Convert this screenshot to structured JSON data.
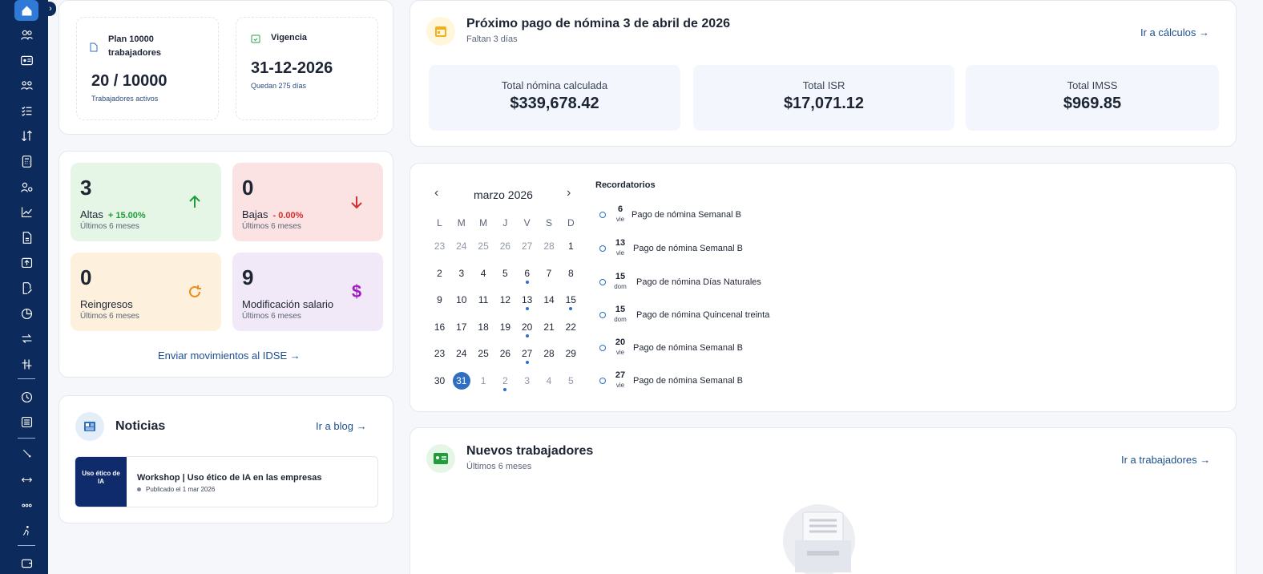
{
  "sidebar": {
    "icons": [
      "home-icon",
      "users-icon",
      "id-card-icon",
      "team-icon",
      "checklist-icon",
      "transfer-icon",
      "calculator-icon",
      "employee-key-icon",
      "chart-line-icon",
      "document-icon",
      "upload-icon",
      "edit-document-icon",
      "pie-chart-icon",
      "swap-icon",
      "adjust-icon",
      "clock-icon",
      "list-icon",
      "diagonal-icon",
      "dots-link-icon",
      "dots-icon",
      "run-icon",
      "wallet-icon"
    ]
  },
  "plan": {
    "plan_label": "Plan 10000 trabajadores",
    "plan_value": "20 / 10000",
    "plan_sub": "Trabajadores activos",
    "vigencia_label": "Vigencia",
    "vigencia_value": "31-12-2026",
    "vigencia_sub": "Quedan 275 días"
  },
  "payroll": {
    "title": "Próximo pago de nómina 3 de abril de 2026",
    "subtitle": "Faltan 3 días",
    "link": "Ir a cálculos →",
    "totals": [
      {
        "label": "Total nómina calculada",
        "value": "$339,678.42"
      },
      {
        "label": "Total ISR",
        "value": "$17,071.12"
      },
      {
        "label": "Total IMSS",
        "value": "$969.85"
      }
    ]
  },
  "movements": {
    "altas": {
      "value": "3",
      "label": "Altas",
      "pct": "+ 15.00%",
      "sub": "Últimos 6 meses",
      "color": "#1f9d3a"
    },
    "bajas": {
      "value": "0",
      "label": "Bajas",
      "pct": "- 0.00%",
      "sub": "Últimos 6 meses",
      "color": "#d62d2d"
    },
    "reingresos": {
      "value": "0",
      "label": "Reingresos",
      "sub": "Últimos 6 meses"
    },
    "salario": {
      "value": "9",
      "label": "Modificación salario",
      "sub": "Últimos 6 meses"
    },
    "link": "Enviar movimientos al IDSE →"
  },
  "calendar": {
    "month": "marzo 2026",
    "weekdays": [
      "L",
      "M",
      "M",
      "J",
      "V",
      "S",
      "D"
    ],
    "weeks": [
      [
        "23",
        "24",
        "25",
        "26",
        "27",
        "28",
        "1"
      ],
      [
        "2",
        "3",
        "4",
        "5",
        "6",
        "7",
        "8"
      ],
      [
        "9",
        "10",
        "11",
        "12",
        "13",
        "14",
        "15"
      ],
      [
        "16",
        "17",
        "18",
        "19",
        "20",
        "21",
        "22"
      ],
      [
        "23",
        "24",
        "25",
        "26",
        "27",
        "28",
        "29"
      ],
      [
        "30",
        "31",
        "1",
        "2",
        "3",
        "4",
        "5"
      ]
    ],
    "reminders_title": "Recordatorios",
    "reminders": [
      {
        "day": "6",
        "weekday": "vie",
        "text": "Pago de nómina Semanal B"
      },
      {
        "day": "13",
        "weekday": "vie",
        "text": "Pago de nómina Semanal B"
      },
      {
        "day": "15",
        "weekday": "dom",
        "text": "Pago de nómina Días Naturales"
      },
      {
        "day": "15",
        "weekday": "dom",
        "text": "Pago de nómina Quincenal treinta"
      },
      {
        "day": "20",
        "weekday": "vie",
        "text": "Pago de nómina Semanal B"
      },
      {
        "day": "27",
        "weekday": "vie",
        "text": "Pago de nómina Semanal B"
      }
    ]
  },
  "news": {
    "title": "Noticias",
    "link": "Ir a blog →",
    "item_title": "Workshop | Uso ético de IA en las empresas",
    "item_date": "Publicado el 1 mar 2026",
    "thumb_text": "Uso ético de IA"
  },
  "workers": {
    "title": "Nuevos trabajadores",
    "subtitle": "Últimos 6 meses",
    "link": "Ir a trabajadores →"
  }
}
